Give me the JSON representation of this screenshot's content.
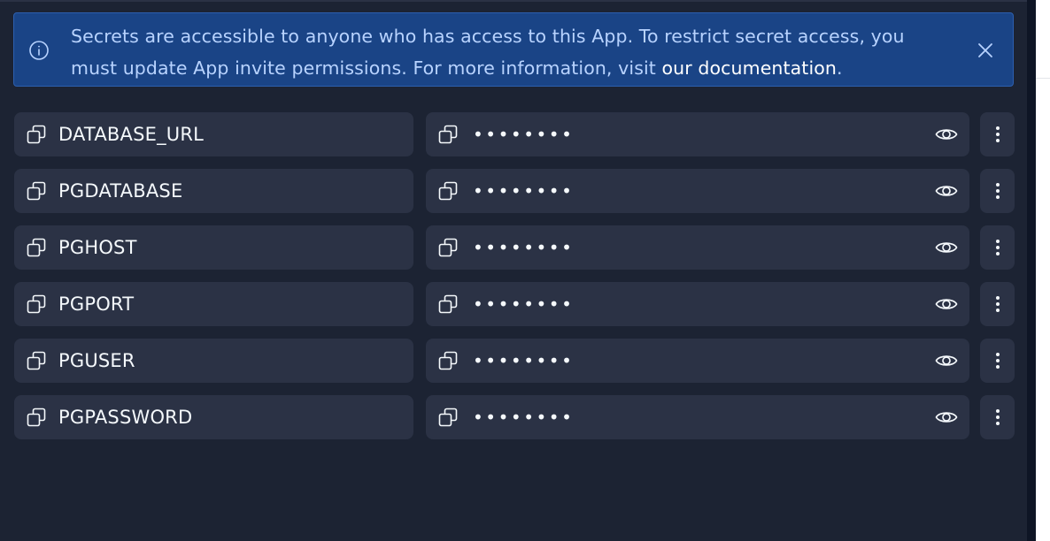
{
  "banner": {
    "icon": "info-icon",
    "text_part1": "Secrets are accessible to anyone who has access to this App. To restrict secret access, you must update App invite permissions. For more information, visit ",
    "link_text": "our documentation",
    "text_part2": ".",
    "close_icon": "close-icon"
  },
  "secrets": [
    {
      "key": "DATABASE_URL",
      "value": "••••••••"
    },
    {
      "key": "PGDATABASE",
      "value": "••••••••"
    },
    {
      "key": "PGHOST",
      "value": "••••••••"
    },
    {
      "key": "PGPORT",
      "value": "••••••••"
    },
    {
      "key": "PGUSER",
      "value": "••••••••"
    },
    {
      "key": "PGPASSWORD",
      "value": "••••••••"
    }
  ],
  "icons": {
    "copy": "copy-icon",
    "reveal": "eye-icon",
    "menu": "kebab-menu-icon"
  },
  "colors": {
    "background": "#1c2333",
    "row": "#2b3245",
    "banner": "#1a4486",
    "banner_text": "#b8d3ff",
    "text": "#f5f9fc"
  }
}
